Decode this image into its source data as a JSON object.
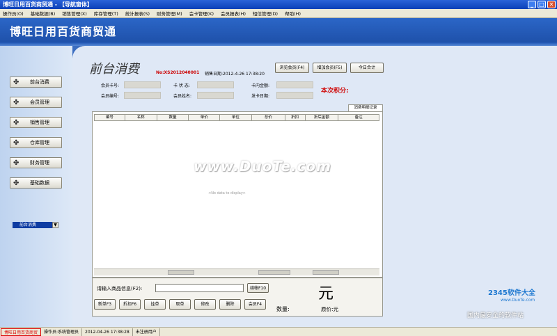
{
  "window": {
    "title": "博旺日用百货商贸通 - 【导航窗体】"
  },
  "menu": [
    "操作员(O)",
    "基础数据(B)",
    "销售管理(X)",
    "库存管理(T)",
    "统计报表(S)",
    "财务管理(M)",
    "会卡管理(K)",
    "会员报表(H)",
    "短信管理(D)",
    "帮助(H)"
  ],
  "header": {
    "title": "博旺日用百货商贸通"
  },
  "sidebar": {
    "items": [
      {
        "label": "前台消费"
      },
      {
        "label": "会员管理"
      },
      {
        "label": "销售管理"
      },
      {
        "label": "仓库管理"
      },
      {
        "label": "财务管理"
      },
      {
        "label": "基础数据"
      }
    ],
    "selector": "前台消费"
  },
  "main": {
    "page_title": "前台消费",
    "member_no_label": "No:",
    "member_no": "XS2012040001",
    "sale_date_label": "销售日期:",
    "sale_date": "2012-4-26 17:38:20",
    "buttons": {
      "browse": "浏览会员(F4)",
      "add": "增加会员(F5)",
      "today": "今日合计"
    },
    "fields": {
      "card_no": "会员卡号:",
      "card_status": "卡 状 态:",
      "card_amount": "卡内金额:",
      "member_id": "会员编号:",
      "member_name": "会员姓名:",
      "card_date": "发卡日期:"
    },
    "score_label": "本次积分:",
    "tab_label": "消费明细记录",
    "columns": [
      "编号",
      "名称",
      "数量",
      "单价",
      "单位",
      "总价",
      "折扣",
      "折后金额",
      "备注"
    ],
    "no_data": "<No data to display>",
    "input_label": "请输入商品信息(F2):",
    "input_value": "",
    "settle_button": "结帐F10",
    "currency": "元",
    "quantity_label": "数量:",
    "price_label": "原价:元",
    "action_buttons": [
      "新单F3",
      "折扣F6",
      "挂单",
      "取单",
      "修改",
      "删除",
      "会员F4"
    ]
  },
  "watermark": "www.DuoTe.com",
  "statusbar": {
    "app": "博旺日用百货商贸",
    "operator": "操作员:系统管理员",
    "datetime": "2012-04-26 17:38:28",
    "user": "未注册用户"
  },
  "logo": {
    "brand": "2345软件大全",
    "site": "www.DuoTe.com",
    "slogan": "国内最安全的软件站"
  }
}
